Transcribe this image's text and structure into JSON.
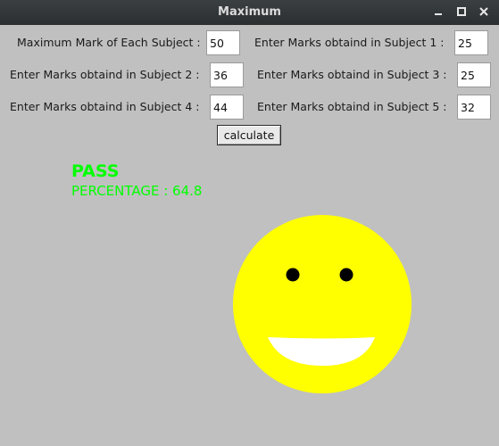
{
  "window": {
    "title": "Maximum"
  },
  "icons": {
    "minimize": "minimize-icon",
    "maximize": "maximize-icon",
    "close": "close-icon"
  },
  "form": {
    "max_mark": {
      "label": "Maximum Mark of Each Subject :",
      "value": "50"
    },
    "subject1": {
      "label": "Enter Marks obtaind in Subject 1 :",
      "value": "25"
    },
    "subject2": {
      "label": "Enter Marks obtaind in Subject 2 :",
      "value": "36"
    },
    "subject3": {
      "label": "Enter Marks obtaind in Subject 3 :",
      "value": "25"
    },
    "subject4": {
      "label": "Enter Marks obtaind in Subject 4 :",
      "value": "44"
    },
    "subject5": {
      "label": "Enter Marks obtaind in Subject 5 :",
      "value": "32"
    },
    "calculate_label": "calculate"
  },
  "result": {
    "status": "PASS",
    "percentage_text": "PERCENTAGE : 64.8"
  },
  "colors": {
    "background": "#c0c0c0",
    "result_text": "#00ff00",
    "face": "#ffff00",
    "eyes": "#000000",
    "mouth": "#ffffff"
  },
  "illustration": {
    "face": "smiling-face-icon"
  }
}
